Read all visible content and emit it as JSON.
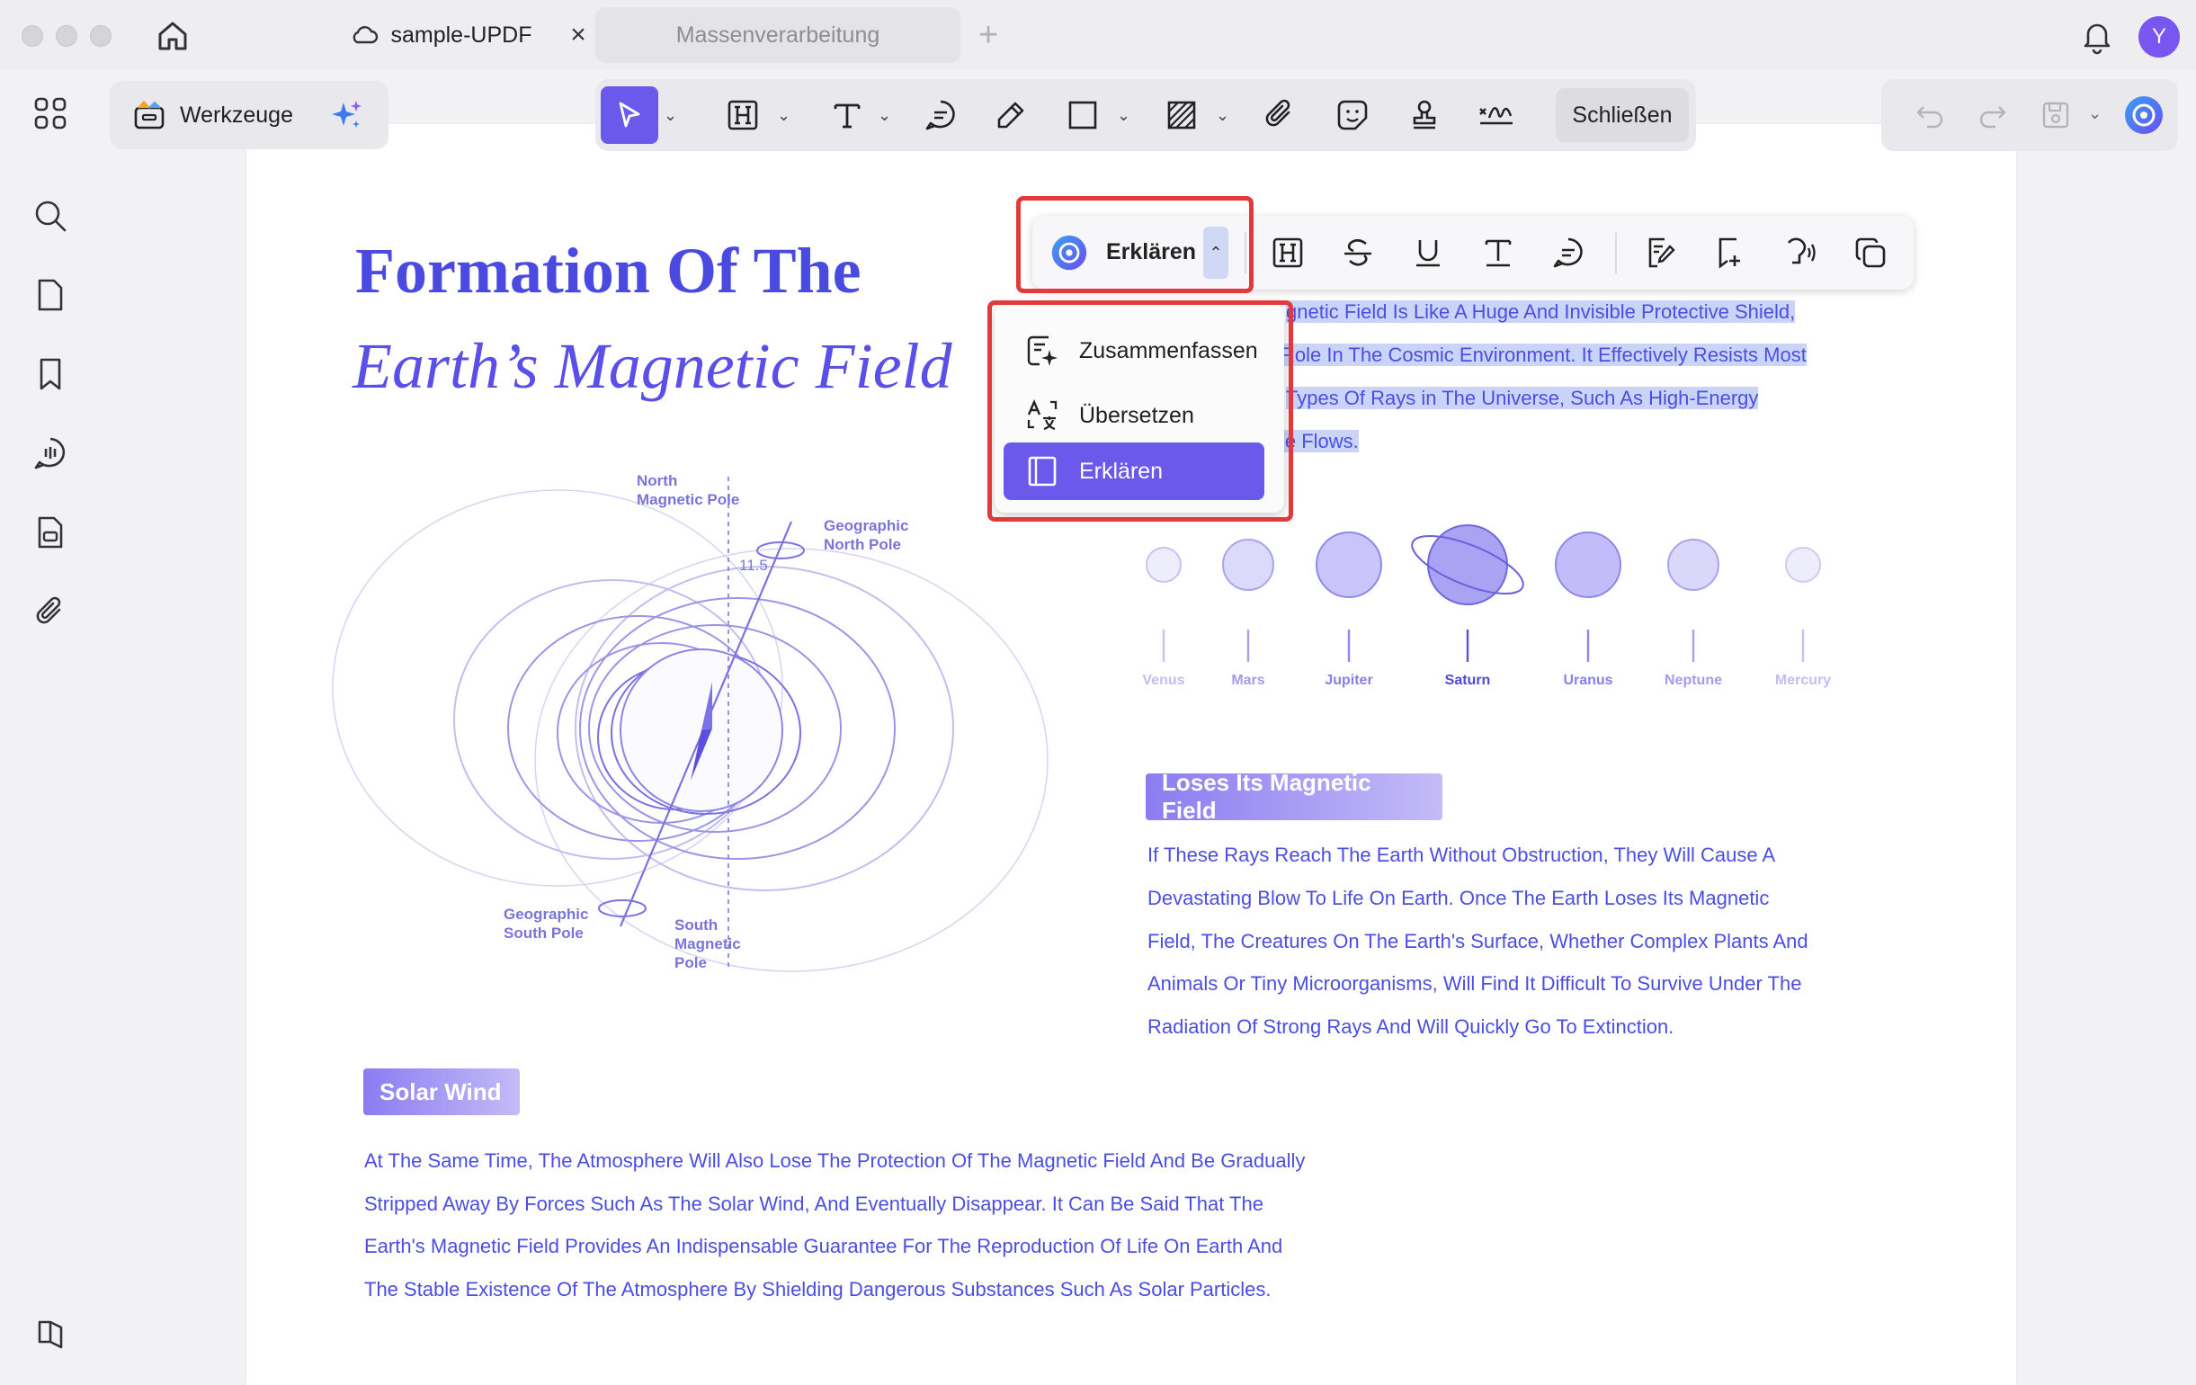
{
  "window": {
    "tab_active": "sample-UPDF",
    "tab_inactive": "Massenverarbeitung",
    "avatar_letter": "Y"
  },
  "toolbar": {
    "tools_label": "Werkzeuge",
    "close_label": "Schließen"
  },
  "float_toolbar": {
    "ai_label": "Erklären"
  },
  "ai_menu": {
    "items": [
      {
        "label": "Zusammenfassen",
        "icon": "summarize-icon"
      },
      {
        "label": "Übersetzen",
        "icon": "translate-icon"
      },
      {
        "label": "Erklären",
        "icon": "book-icon",
        "active": true
      }
    ]
  },
  "document": {
    "title_line1": "Formation Of The",
    "title_line2": "Earth’s Magnetic Field",
    "selected_lines": [
      "gnetic Field Is Like A Huge And Invisible Protective Shield,",
      "Role In The Cosmic Environment. It Effectively Resists Most",
      "Types Of Rays in The Universe, Such As High-Energy",
      "le Flows."
    ],
    "planets": [
      "Venus",
      "Mars",
      "Jupiter",
      "Saturn",
      "Uranus",
      "Neptune",
      "Mercury"
    ],
    "diagram_labels": {
      "north_magnetic": "North\nMagnetic Pole",
      "geo_north": "Geographic\nNorth Pole",
      "angle": "11.5",
      "geo_south": "Geographic\nSouth Pole",
      "south_magnetic": "South\nMagnetic\nPole"
    },
    "section_magnetic": {
      "heading": "Loses Its Magnetic Field",
      "lines": [
        "If These Rays Reach The Earth Without Obstruction, They Will Cause A",
        "Devastating Blow To Life On Earth. Once The Earth Loses Its Magnetic",
        "Field, The Creatures On The Earth's Surface, Whether Complex Plants And",
        "Animals Or Tiny Microorganisms, Will Find It Difficult To Survive Under The",
        "Radiation Of Strong Rays And Will Quickly Go To Extinction."
      ]
    },
    "section_solar": {
      "heading": "Solar Wind",
      "lines": [
        "At The Same Time, The Atmosphere Will Also Lose The Protection Of The Magnetic Field And Be Gradually",
        "Stripped Away By Forces Such As The Solar Wind, And Eventually Disappear. It Can Be Said That The",
        "Earth's Magnetic Field Provides An Indispensable Guarantee For The Reproduction Of Life On Earth And",
        "The Stable Existence Of The Atmosphere By Shielding Dangerous Substances Such As Solar Particles."
      ]
    }
  },
  "colors": {
    "accent": "#6a59ea",
    "doc_text": "#4b4ee0",
    "highlight": "#c9d4f8",
    "callout_border": "#e2393c"
  }
}
